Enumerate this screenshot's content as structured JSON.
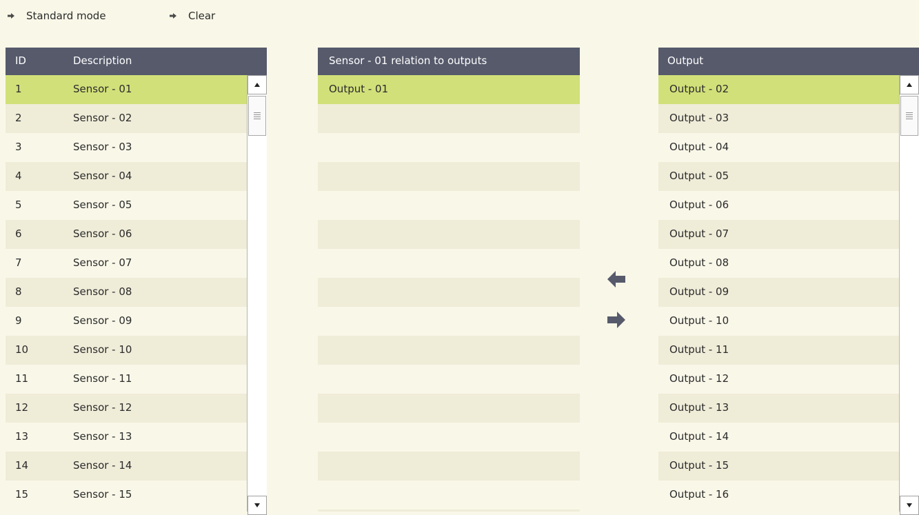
{
  "toolbar": {
    "standard_mode_label": "Standard mode",
    "clear_label": "Clear"
  },
  "sensors": {
    "headers": {
      "id": "ID",
      "description": "Description"
    },
    "selected_index": 0,
    "rows": [
      {
        "id": "1",
        "description": "Sensor - 01"
      },
      {
        "id": "2",
        "description": "Sensor - 02"
      },
      {
        "id": "3",
        "description": "Sensor - 03"
      },
      {
        "id": "4",
        "description": "Sensor - 04"
      },
      {
        "id": "5",
        "description": "Sensor - 05"
      },
      {
        "id": "6",
        "description": "Sensor - 06"
      },
      {
        "id": "7",
        "description": "Sensor - 07"
      },
      {
        "id": "8",
        "description": "Sensor - 08"
      },
      {
        "id": "9",
        "description": "Sensor - 09"
      },
      {
        "id": "10",
        "description": "Sensor - 10"
      },
      {
        "id": "11",
        "description": "Sensor - 11"
      },
      {
        "id": "12",
        "description": "Sensor - 12"
      },
      {
        "id": "13",
        "description": "Sensor - 13"
      },
      {
        "id": "14",
        "description": "Sensor - 14"
      },
      {
        "id": "15",
        "description": "Sensor - 15"
      }
    ]
  },
  "relation": {
    "header": "Sensor - 01 relation to outputs",
    "selected_index": 0,
    "rows": [
      "Output - 01"
    ]
  },
  "outputs": {
    "header": "Output",
    "selected_index": 0,
    "rows": [
      "Output - 02",
      "Output - 03",
      "Output - 04",
      "Output - 05",
      "Output - 06",
      "Output - 07",
      "Output - 08",
      "Output - 09",
      "Output - 10",
      "Output - 11",
      "Output - 12",
      "Output - 13",
      "Output - 14",
      "Output - 15",
      "Output - 16"
    ]
  },
  "icons": {
    "toolbar_arrow": "arrow-right-icon",
    "move_left": "arrow-left-icon",
    "move_right": "arrow-right-icon",
    "scroll_up": "triangle-up-icon",
    "scroll_down": "triangle-down-icon"
  },
  "colors": {
    "header_bg": "#565a6b",
    "selected_row": "#d2e07a",
    "row_alt": "#efecd8",
    "background": "#f9f7e8",
    "arrow": "#565a6b"
  }
}
